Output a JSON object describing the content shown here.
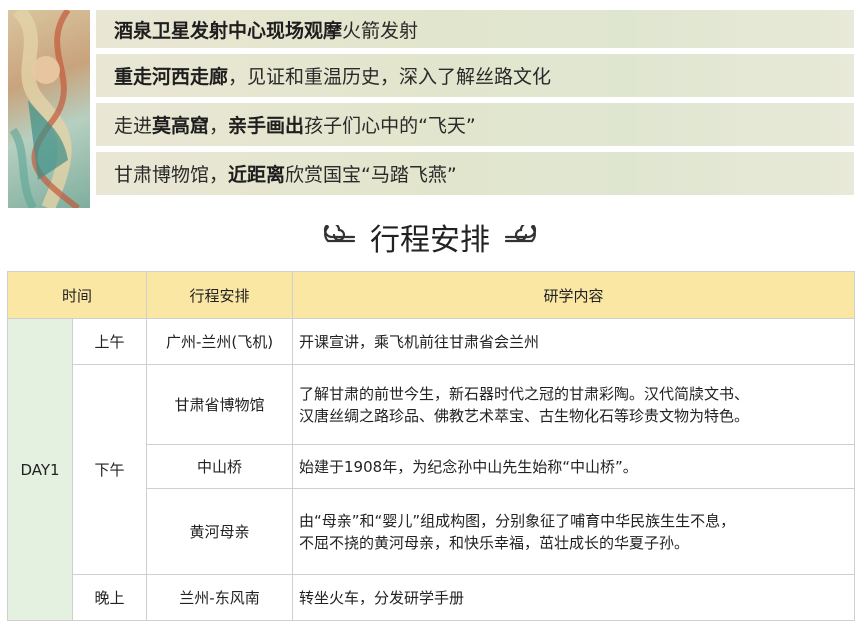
{
  "highlights": [
    {
      "bold": "酒泉卫星发射中心现场观摩",
      "rest": "火箭发射"
    },
    {
      "bold": "重走河西走廊",
      "rest": "，见证和重温历史，深入了解丝路文化"
    },
    {
      "pre": "走进",
      "bold1": "莫高窟",
      "mid": "，",
      "bold2": "亲手画出",
      "rest": "孩子们心中的“飞天”"
    },
    {
      "pre": "甘肃博物馆，",
      "bold": "近距离",
      "rest": "欣赏国宝“马踏飞燕”"
    }
  ],
  "section_title": "行程安排",
  "table": {
    "headers": {
      "time": "时间",
      "schedule": "行程安排",
      "content": "研学内容"
    },
    "day": "DAY1",
    "periods": {
      "morning": "上午",
      "afternoon": "下午",
      "evening": "晚上"
    },
    "rows": [
      {
        "schedule": "广州-兰州(飞机)",
        "content": "开课宣讲，乘飞机前往甘肃省会兰州"
      },
      {
        "schedule": "甘肃省博物馆",
        "content_line1": "了解甘肃的前世今生，新石器时代之冠的甘肃彩陶。汉代简牍文书、",
        "content_line2": "汉唐丝绸之路珍品、佛教艺术萃宝、古生物化石等珍贵文物为特色。"
      },
      {
        "schedule": "中山桥",
        "content": "始建于1908年，为纪念孙中山先生始称“中山桥”。"
      },
      {
        "schedule": "黄河母亲",
        "content_line1": "由“母亲”和“婴儿”组成构图，分别象征了哺育中华民族生生不息，",
        "content_line2": "不屈不挠的黄河母亲，和快乐幸福，茁壮成长的华夏子孙。"
      },
      {
        "schedule": "兰州-东风南",
        "content": "转坐火车，分发研学手册"
      }
    ]
  }
}
